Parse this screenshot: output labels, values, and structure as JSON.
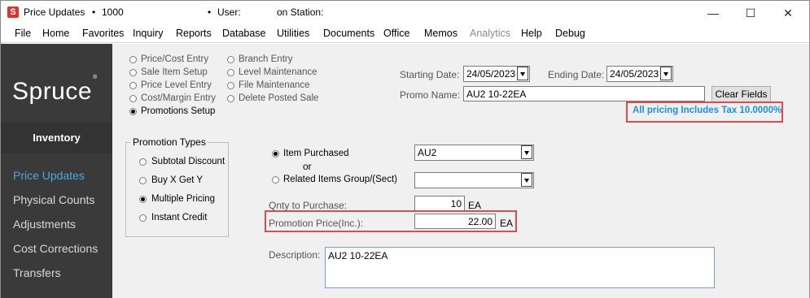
{
  "window": {
    "title": "Price Updates",
    "store": "1000",
    "user_label": "User:",
    "station_label": "on Station:",
    "minimize": "—",
    "maximize": "☐",
    "close": "✕"
  },
  "menu": [
    "File",
    "Home",
    "Favorites",
    "Inquiry",
    "Reports",
    "Database",
    "Utilities",
    "Documents",
    "Office",
    "Memos",
    "Analytics",
    "Help",
    "Debug"
  ],
  "menu_disabled": [
    "Analytics"
  ],
  "sidebar": {
    "logo": "Spruce",
    "logo_mark": "®",
    "section": "Inventory",
    "items": [
      "Price Updates",
      "Physical Counts",
      "Adjustments",
      "Cost Corrections",
      "Transfers"
    ],
    "active": "Price Updates",
    "active_color": "#4aa7e8"
  },
  "modes": {
    "col1": [
      "Price/Cost Entry",
      "Sale Item Setup",
      "Price Level Entry",
      "Cost/Margin Entry",
      "Promotions Setup"
    ],
    "col2": [
      "Branch Entry",
      "Level Maintenance",
      "File Maintenance",
      "Delete Posted Sale"
    ],
    "selected": "Promotions Setup"
  },
  "dates": {
    "starting_label": "Starting Date:",
    "starting_value": "24/05/2023",
    "ending_label": "Ending Date:",
    "ending_value": "24/05/2023"
  },
  "promo": {
    "name_label": "Promo Name:",
    "name_value": "AU2 10-22EA",
    "clear_button": "Clear Fields",
    "tax_note": "All pricing Includes Tax 10.0000%"
  },
  "promotion_types": {
    "title": "Promotion Types",
    "options": [
      "Subtotal Discount",
      "Buy X Get Y",
      "Multiple Pricing",
      "Instant Credit"
    ],
    "selected": "Multiple Pricing"
  },
  "item": {
    "item_purchased_label": "Item Purchased",
    "or_label": "or",
    "related_label": "Related Items Group/(Sect)",
    "selected": "Item Purchased",
    "item_value": "AU2",
    "related_value": "",
    "qty_label": "Qnty to Purchase:",
    "qty_value": "10",
    "qty_unit": "EA",
    "price_label": "Promotion Price(Inc.):",
    "price_value": "22.00",
    "price_unit": "EA",
    "description_label": "Description:",
    "description_value": "AU2 10-22EA"
  },
  "colors": {
    "sidebar_bg": "#3a3a3a",
    "highlight": "#e04a4a",
    "tax_note": "#1e8ee8",
    "app_icon": "#e0312b"
  },
  "icons": {
    "app": "spruce-s-icon",
    "dropdown": "chevron-down-icon"
  }
}
